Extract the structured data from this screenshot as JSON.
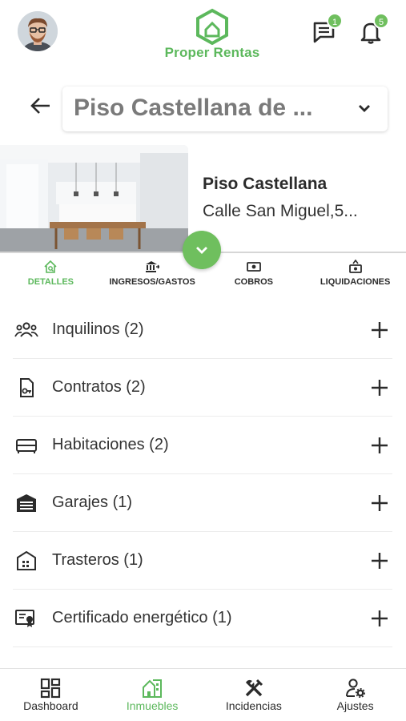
{
  "header": {
    "avatar_icon": "user-avatar",
    "brand": "Proper Rentas",
    "messages_badge": "1",
    "notifications_badge": "5"
  },
  "selector": {
    "value": "Piso Castellana de ..."
  },
  "property": {
    "name": "Piso Castellana",
    "address": "Calle San Miguel,5..."
  },
  "tabs": [
    {
      "label": "DETALLES",
      "icon": "house-search-icon",
      "active": true
    },
    {
      "label": "INGRESOS/GASTOS",
      "icon": "bank-icon",
      "active": false
    },
    {
      "label": "COBROS",
      "icon": "cash-icon",
      "active": false
    },
    {
      "label": "LIQUIDACIONES",
      "icon": "cash-register-icon",
      "active": false
    }
  ],
  "sections": [
    {
      "label": "Inquilinos (2)",
      "icon": "group-icon"
    },
    {
      "label": "Contratos (2)",
      "icon": "contract-icon"
    },
    {
      "label": "Habitaciones (2)",
      "icon": "bed-icon"
    },
    {
      "label": "Garajes (1)",
      "icon": "garage-icon"
    },
    {
      "label": "Trasteros (1)",
      "icon": "storage-icon"
    },
    {
      "label": "Certificado energético (1)",
      "icon": "certificate-icon"
    }
  ],
  "bottom_nav": [
    {
      "label": "Dashboard",
      "icon": "dashboard-icon",
      "active": false
    },
    {
      "label": "Inmuebles",
      "icon": "building-icon",
      "active": true
    },
    {
      "label": "Incidencias",
      "icon": "tools-icon",
      "active": false
    },
    {
      "label": "Ajustes",
      "icon": "user-settings-icon",
      "active": false
    }
  ],
  "colors": {
    "accent": "#5cb85c",
    "badge": "#6fbf5e",
    "text": "#2b2b2b"
  }
}
